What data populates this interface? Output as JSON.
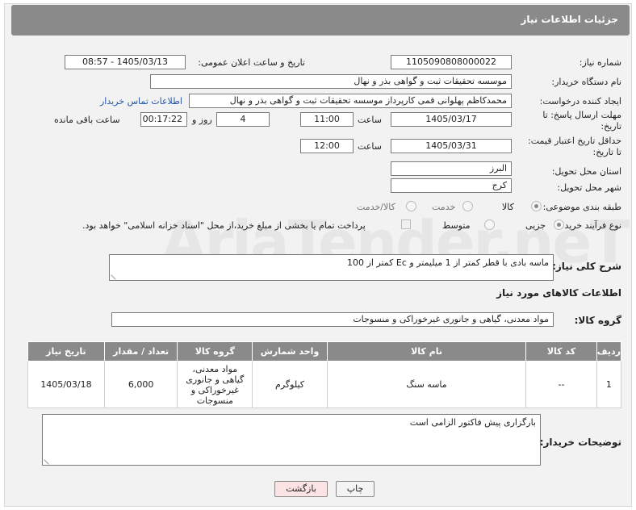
{
  "header": {
    "title": "جزئیات اطلاعات نیاز"
  },
  "watermark": "AriaTender.neT",
  "fields": {
    "need_number_label": "شماره نیاز:",
    "need_number": "1105090808000022",
    "announce_label": "تاریخ و ساعت اعلان عمومی:",
    "announce_value": "1405/03/13 - 08:57",
    "buyer_org_label": "نام دستگاه خریدار:",
    "buyer_org": "موسسه تحقیقات ثبت و گواهی بذر و نهال",
    "creator_label": "ایجاد کننده درخواست:",
    "creator": "محمدکاظم پهلوانی قمی کارپرداز موسسه تحقیقات ثبت و گواهی بذر و نهال",
    "contact_link": "اطلاعات تماس خریدار",
    "deadline_label_1": "مهلت ارسال پاسخ: تا",
    "deadline_label_2": "تاریخ:",
    "deadline_date": "1405/03/17",
    "time_label": "ساعت",
    "deadline_time": "11:00",
    "days_value": "4",
    "days_label": "روز و",
    "remaining_value": "00:17:22",
    "remaining_label": "ساعت باقی مانده",
    "validity_label_1": "حداقل تاریخ اعتبار قیمت:",
    "validity_label_2": "تا تاریخ:",
    "validity_date": "1405/03/31",
    "validity_time": "12:00",
    "province_label": "استان محل تحویل:",
    "province": "البرز",
    "city_label": "شهر محل تحویل:",
    "city": "کرج",
    "category_label": "طبقه بندی موضوعی:",
    "category_options": [
      "کالا",
      "خدمت",
      "کالا/خدمت"
    ],
    "process_label": "نوع فرآیند خرید :",
    "process_options": [
      "جزیی",
      "متوسط"
    ],
    "payment_note": "پرداخت تمام یا بخشی از مبلغ خرید،از محل \"اسناد خزانه اسلامی\" خواهد بود.",
    "desc_label": "شرح کلی نیاز:",
    "desc_value": "ماسه بادی با قطر کمتر از 1 میلیمتر و  Ec کمتر از 100",
    "goods_info_label": "اطلاعات کالاهای مورد نیاز",
    "goods_group_label": "گروه کالا:",
    "goods_group": "مواد معدنی، گیاهی و جانوری غیرخوراکی و منسوجات"
  },
  "table": {
    "columns": [
      "ردیف",
      "کد کالا",
      "نام کالا",
      "واحد شمارش",
      "گروه کالا",
      "تعداد / مقدار",
      "تاریخ نیاز"
    ],
    "rows": [
      [
        "1",
        "--",
        "ماسه سنگ",
        "کیلوگرم",
        "مواد معدنی، گیاهی و جانوری غیرخوراکی و منسوجات",
        "6,000",
        "1405/03/18"
      ]
    ]
  },
  "buyer_notes_label": "توضیحات خریدار:",
  "buyer_notes": "بارگزاری پیش فاکتور الزامی است",
  "buttons": {
    "print": "چاپ",
    "back": "بازگشت"
  }
}
